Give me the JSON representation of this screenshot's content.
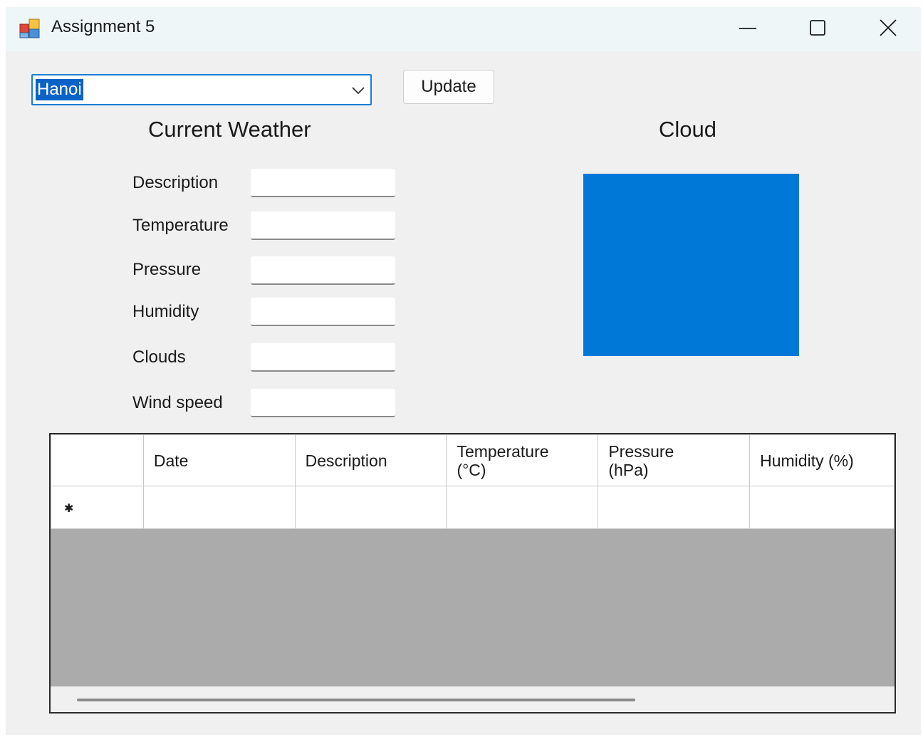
{
  "window": {
    "title": "Assignment 5"
  },
  "toolbar": {
    "city_select": {
      "value": "Hanoi",
      "options": [
        "Hanoi"
      ]
    },
    "update_label": "Update"
  },
  "current_weather": {
    "heading": "Current Weather",
    "fields": [
      {
        "label": "Description",
        "value": ""
      },
      {
        "label": "Temperature",
        "value": ""
      },
      {
        "label": "Pressure",
        "value": ""
      },
      {
        "label": "Humidity",
        "value": ""
      },
      {
        "label": "Clouds",
        "value": ""
      },
      {
        "label": "Wind speed",
        "value": ""
      }
    ]
  },
  "cloud": {
    "heading": "Cloud",
    "color": "#0078d7"
  },
  "forecast_grid": {
    "columns": [
      {
        "line1": "Date",
        "line2": ""
      },
      {
        "line1": "Description",
        "line2": ""
      },
      {
        "line1": "Temperature",
        "line2": "(°C)"
      },
      {
        "line1": "Pressure",
        "line2": "(hPa)"
      },
      {
        "line1": "Humidity (%)",
        "line2": ""
      }
    ],
    "new_row_marker": "✱",
    "rows": []
  },
  "colors": {
    "title_bar": "#eef6f8",
    "window_bg": "#f0f0f0",
    "selection": "#0a62c7",
    "focus_border": "#1a7fd6",
    "grid_empty_bg": "#ababab"
  },
  "icons": {
    "app": "app-window-icon",
    "minimize": "minimize-icon",
    "maximize": "maximize-icon",
    "close": "close-icon",
    "dropdown": "chevron-down-icon"
  }
}
